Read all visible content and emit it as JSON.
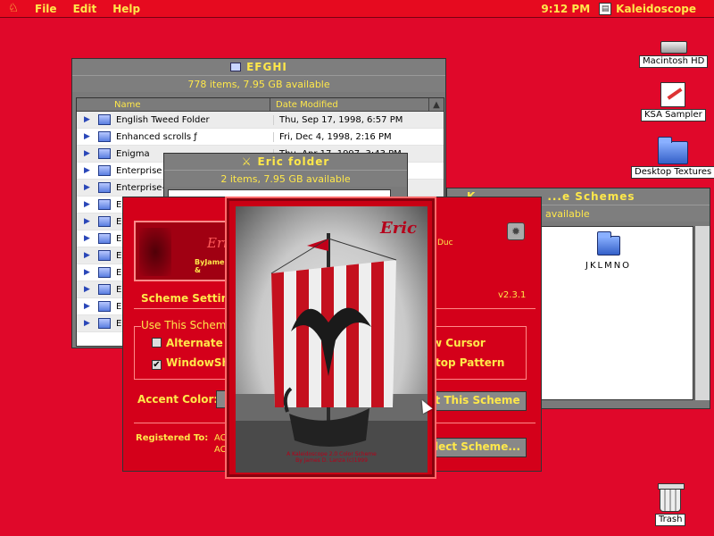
{
  "menubar": {
    "menus": [
      "File",
      "Edit",
      "Help"
    ],
    "clock": "9:12 PM",
    "active_app": "Kaleidoscope"
  },
  "desktop": {
    "icons": [
      {
        "label": "Macintosh HD",
        "icon": "hard-drive-icon"
      },
      {
        "label": "KSA Sampler",
        "icon": "document-icon"
      },
      {
        "label": "Desktop Textures",
        "icon": "folder-icon"
      },
      {
        "label": "Trash",
        "icon": "trash-icon"
      }
    ]
  },
  "efghi": {
    "title": "EFGHI",
    "info": "778 items, 7.95 GB available",
    "columns": [
      "Name",
      "Date Modified"
    ],
    "rows": [
      {
        "name": "English Tweed Folder",
        "date": "Thu, Sep 17, 1998, 6:57 PM"
      },
      {
        "name": "Enhanced scrolls ƒ",
        "date": "Fri, Dec 4, 1998, 2:16 PM"
      },
      {
        "name": "Enigma",
        "date": "Thu, Apr 17, 1997, 3:43 PM"
      },
      {
        "name": "Enterprise",
        "date": ""
      },
      {
        "name": "Enterprise-",
        "date": ""
      },
      {
        "name": "En",
        "date": ""
      },
      {
        "name": "En",
        "date": ""
      },
      {
        "name": "Ep",
        "date": ""
      },
      {
        "name": "Eq",
        "date": ""
      },
      {
        "name": "Er",
        "date": ""
      },
      {
        "name": "Er",
        "date": ""
      },
      {
        "name": "Er",
        "date": ""
      },
      {
        "name": "Er",
        "date": ""
      }
    ]
  },
  "eric_folder": {
    "title": "Eric folder",
    "info": "2 items, 7.95 GB available"
  },
  "schemes": {
    "title": "Kaleidoscope Schemes",
    "title_visible": "...e Schemes",
    "title_prefix": "K",
    "info": "available",
    "folder_label": "JKLMNO"
  },
  "kpanel": {
    "banner_text": "Eri",
    "banner_sub": "ByJames &",
    "author_suffix": "Duc",
    "version": "v2.3.1",
    "scheme_settings": "Scheme Setting",
    "use_this_scheme": "Use This Scheme",
    "opt_alternate": "Alternate C",
    "opt_windowsh": "WindowSh",
    "opt_new_cursor": "w Cursor",
    "opt_desktop_pattern": "top Pattern",
    "accent_color": "Accent Color:",
    "set_scheme_btn": "t This Scheme",
    "select_scheme_btn": "lect Scheme...",
    "registered_to": "Registered To:",
    "reg_line1": "AC",
    "reg_line2": "AC"
  },
  "splash": {
    "title": "Eric",
    "credit_line1": "A Kaleidoscope 2.0 Color Scheme",
    "credit_line2": "By James D. Lanza (c)1999"
  }
}
